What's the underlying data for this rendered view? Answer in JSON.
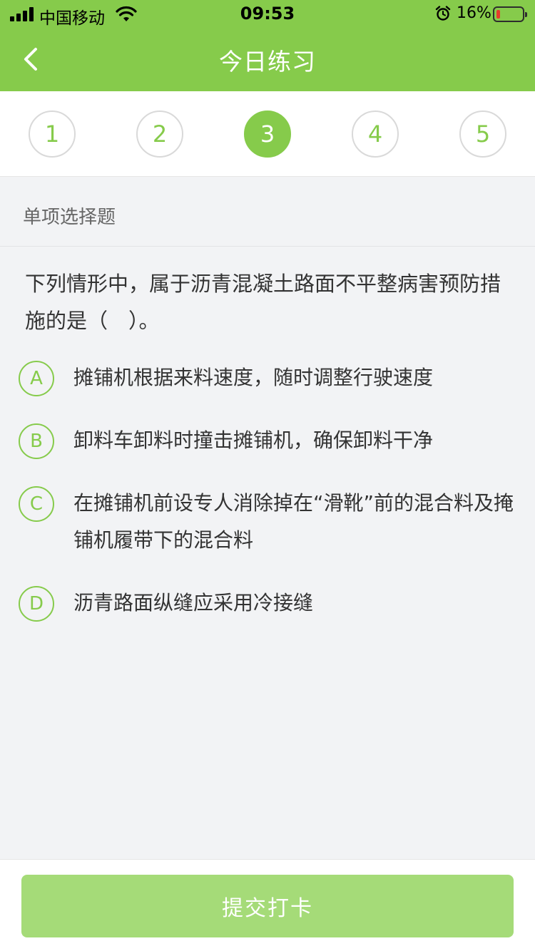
{
  "status_bar": {
    "carrier": "中国移动",
    "time": "09:53",
    "battery": "16%",
    "battery_level": 0.16
  },
  "nav": {
    "title": "今日练习",
    "back_icon": "chevron-left-icon"
  },
  "tabs": [
    {
      "label": "1",
      "active": false
    },
    {
      "label": "2",
      "active": false
    },
    {
      "label": "3",
      "active": true
    },
    {
      "label": "4",
      "active": false
    },
    {
      "label": "5",
      "active": false
    }
  ],
  "question": {
    "type": "单项选择题",
    "text": "下列情形中，属于沥青混凝土路面不平整病害预防措施的是（　）。",
    "options": [
      {
        "letter": "A",
        "text": "摊铺机根据来料速度，随时调整行驶速度"
      },
      {
        "letter": "B",
        "text": "卸料车卸料时撞击摊铺机，确保卸料干净"
      },
      {
        "letter": "C",
        "text": "在摊铺机前设专人消除掉在“滑靴”前的混合料及掩铺机履带下的混合料"
      },
      {
        "letter": "D",
        "text": "沥青路面纵缝应采用冷接缝"
      }
    ]
  },
  "submit_label": "提交打卡",
  "colors": {
    "accent": "#86cb4b",
    "button_disabled": "#a5db78",
    "battery_low": "#e53b2c"
  }
}
